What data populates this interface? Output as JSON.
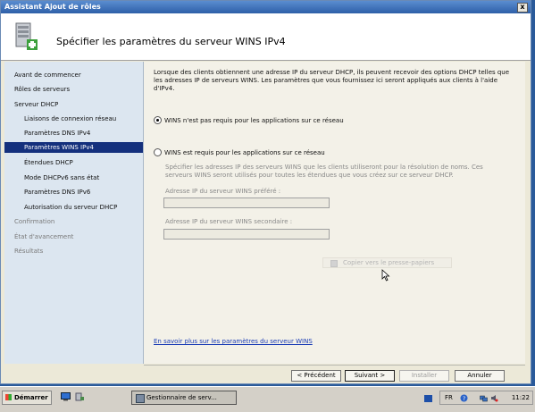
{
  "window": {
    "title": "Assistant Ajout de rôles",
    "close_label": "x"
  },
  "header": {
    "title": "Spécifier les paramètres du serveur WINS IPv4"
  },
  "sidebar": {
    "items": [
      {
        "label": "Avant de commencer"
      },
      {
        "label": "Rôles de serveurs"
      },
      {
        "label": "Serveur DHCP"
      },
      {
        "label": "Liaisons de connexion réseau"
      },
      {
        "label": "Paramètres DNS IPv4"
      },
      {
        "label": "Paramètres WINS IPv4"
      },
      {
        "label": "Étendues DHCP"
      },
      {
        "label": "Mode DHCPv6 sans état"
      },
      {
        "label": "Paramètres DNS IPv6"
      },
      {
        "label": "Autorisation du serveur DHCP"
      },
      {
        "label": "Confirmation"
      },
      {
        "label": "État d'avancement"
      },
      {
        "label": "Résultats"
      }
    ]
  },
  "main": {
    "description": "Lorsque des clients obtiennent une adresse IP du serveur DHCP, ils peuvent recevoir des options DHCP telles que les adresses IP de serveurs WINS. Les paramètres que vous fournissez ici seront appliqués aux clients à l'aide d'IPv4.",
    "option_not_required": "WINS n'est pas requis pour les applications sur ce réseau",
    "option_required": "WINS est requis pour les applications sur ce réseau",
    "sub_description": "Spécifier les adresses IP des serveurs WINS que les clients utiliseront pour la résolution de noms. Ces serveurs WINS seront utilisés pour toutes les étendues que vous créez sur ce serveur DHCP.",
    "preferred_label": "Adresse IP du serveur WINS préféré :",
    "preferred_value": "",
    "secondary_label": "Adresse IP du serveur WINS secondaire :",
    "secondary_value": "",
    "copy_button": "Copier vers le presse-papiers",
    "help_link": "En savoir plus sur les paramètres du serveur WINS"
  },
  "buttons": {
    "previous": "< Précédent",
    "next": "Suivant >",
    "install": "Installer",
    "cancel": "Annuler"
  },
  "taskbar": {
    "start": "Démarrer",
    "task": "Gestionnaire de serv...",
    "lang": "FR",
    "clock": "11:22"
  }
}
